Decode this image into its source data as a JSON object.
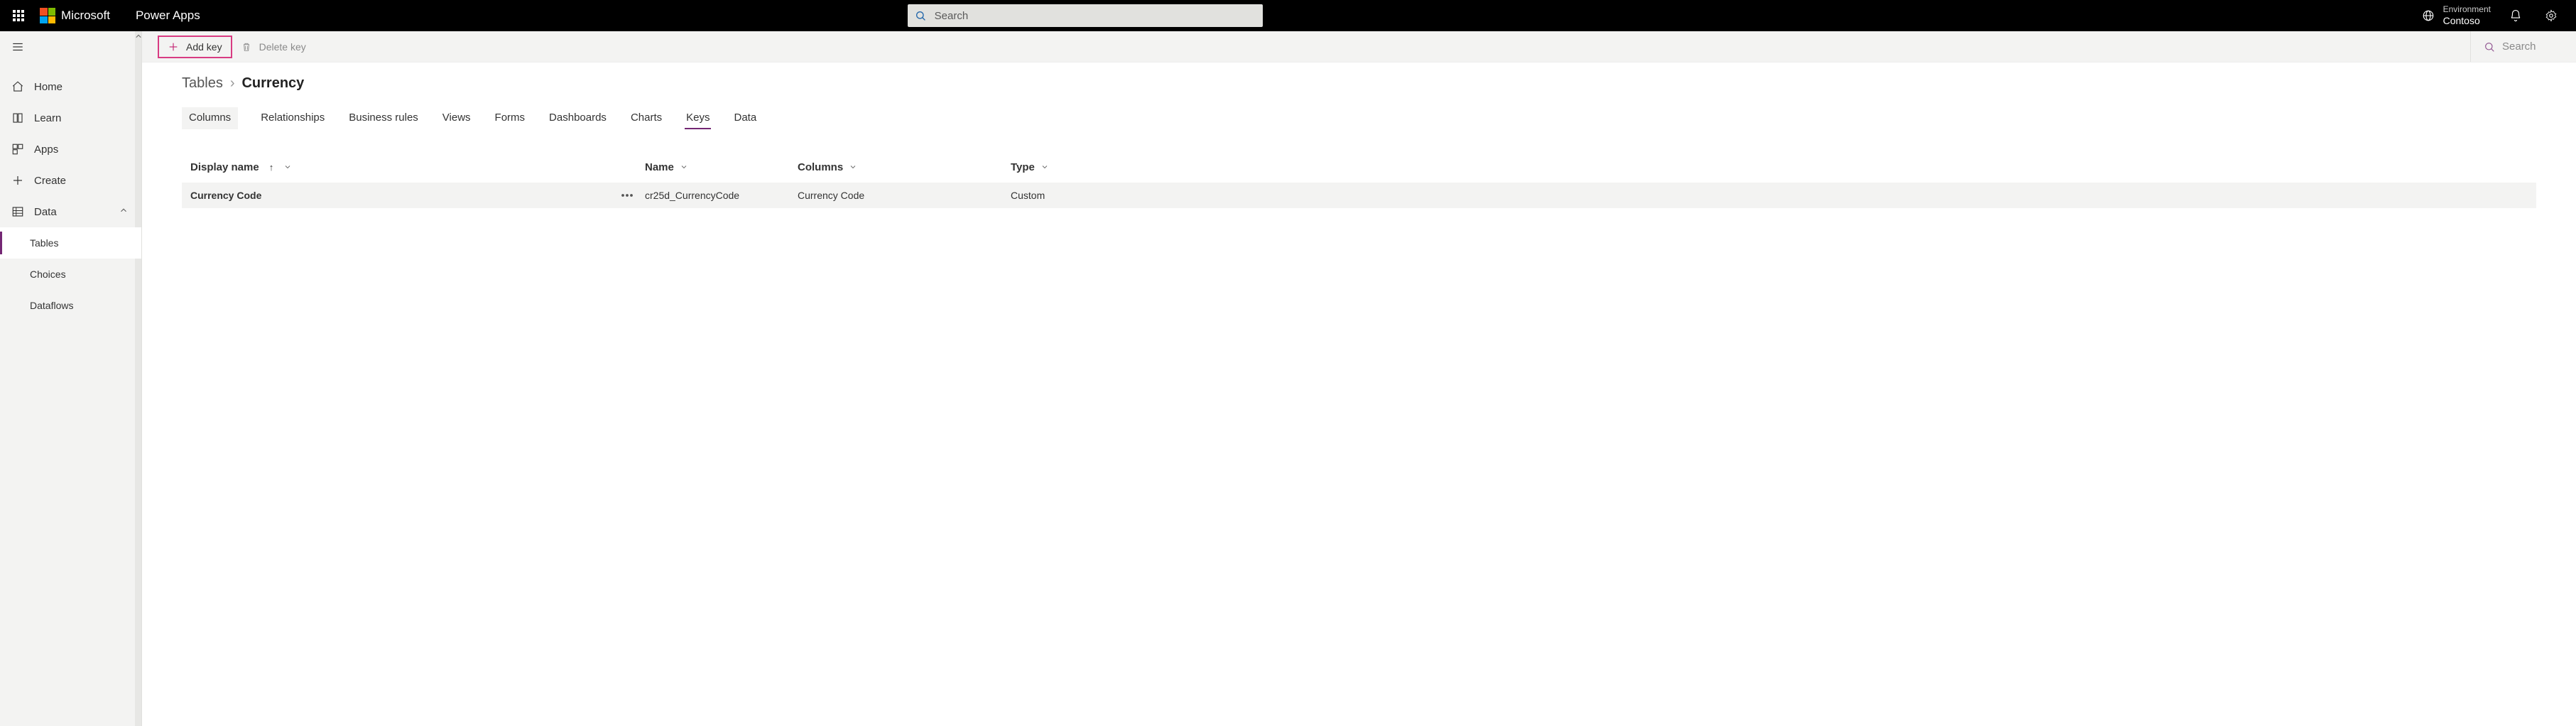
{
  "header": {
    "brand": "Microsoft",
    "app": "Power Apps",
    "search_placeholder": "Search",
    "environment_label": "Environment",
    "environment_name": "Contoso"
  },
  "sidebar": {
    "items": [
      {
        "key": "home",
        "label": "Home"
      },
      {
        "key": "learn",
        "label": "Learn"
      },
      {
        "key": "apps",
        "label": "Apps"
      },
      {
        "key": "create",
        "label": "Create"
      },
      {
        "key": "data",
        "label": "Data"
      }
    ],
    "sub_items": [
      {
        "key": "tables",
        "label": "Tables",
        "selected": true
      },
      {
        "key": "choices",
        "label": "Choices",
        "selected": false
      },
      {
        "key": "dataflows",
        "label": "Dataflows",
        "selected": false
      }
    ]
  },
  "commands": {
    "add_key": "Add key",
    "delete_key": "Delete key",
    "search_placeholder": "Search"
  },
  "breadcrumb": {
    "parent": "Tables",
    "current": "Currency"
  },
  "tabs": [
    "Columns",
    "Relationships",
    "Business rules",
    "Views",
    "Forms",
    "Dashboards",
    "Charts",
    "Keys",
    "Data"
  ],
  "active_tab": "Keys",
  "table": {
    "headers": {
      "display_name": "Display name",
      "name": "Name",
      "columns": "Columns",
      "type": "Type"
    },
    "rows": [
      {
        "display_name": "Currency Code",
        "name": "cr25d_CurrencyCode",
        "columns": "Currency Code",
        "type": "Custom"
      }
    ]
  }
}
